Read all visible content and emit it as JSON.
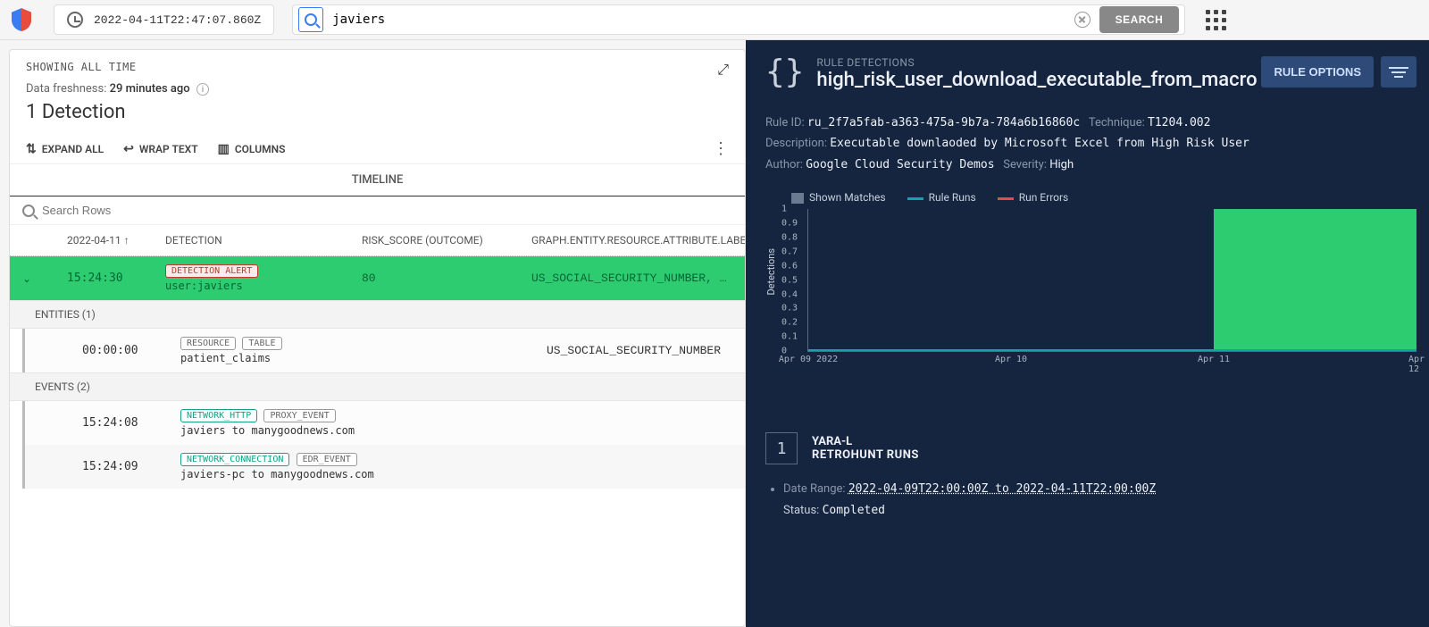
{
  "topbar": {
    "timestamp": "2022-04-11T22:47:07.860Z",
    "search_value": "javiers",
    "search_button": "SEARCH"
  },
  "left": {
    "showing": "SHOWING ALL TIME",
    "freshness_label": "Data freshness: ",
    "freshness_value": "29 minutes ago",
    "count": "1 Detection",
    "tools": {
      "expand": "EXPAND ALL",
      "wrap": "WRAP TEXT",
      "columns": "COLUMNS"
    },
    "timeline": "TIMELINE",
    "row_search_placeholder": "Search Rows",
    "columns": {
      "date": "2022-04-11",
      "detection": "DETECTION",
      "risk": "RISK_SCORE (OUTCOME)",
      "graph": "GRAPH.ENTITY.RESOURCE.ATTRIBUTE.LABELS"
    },
    "alert_row": {
      "time": "15:24:30",
      "badge": "DETECTION ALERT",
      "detail": "user:javiers",
      "risk": "80",
      "graph": "US_SOCIAL_SECURITY_NUMBER, …"
    },
    "entities_header": "ENTITIES (1)",
    "entity_row": {
      "time": "00:00:00",
      "badges": [
        "RESOURCE",
        "TABLE"
      ],
      "detail": "patient_claims",
      "graph": "US_SOCIAL_SECURITY_NUMBER"
    },
    "events_header": "EVENTS (2)",
    "events": [
      {
        "time": "15:24:08",
        "badges": [
          {
            "text": "NETWORK_HTTP",
            "cls": "teal"
          },
          {
            "text": "PROXY_EVENT",
            "cls": "gray"
          }
        ],
        "detail": "javiers to manygoodnews.com"
      },
      {
        "time": "15:24:09",
        "badges": [
          {
            "text": "NETWORK_CONNECTION",
            "cls": "teal"
          },
          {
            "text": "EDR_EVENT",
            "cls": "gray"
          }
        ],
        "detail": "javiers-pc to manygoodnews.com"
      }
    ]
  },
  "right": {
    "subtitle": "RULE DETECTIONS",
    "title": "high_risk_user_download_executable_from_macro",
    "rule_options": "RULE OPTIONS",
    "meta": {
      "rule_id_label": "Rule ID:",
      "rule_id": "ru_2f7a5fab-a363-475a-9b7a-784a6b16860c",
      "technique_label": "Technique:",
      "technique": "T1204.002",
      "desc_label": "Description:",
      "desc": "Executable downlaoded by Microsoft Excel from High Risk User",
      "author_label": "Author:",
      "author": "Google Cloud Security Demos",
      "severity_label": "Severity:",
      "severity": "High"
    },
    "legend": {
      "shown": "Shown Matches",
      "runs": "Rule Runs",
      "errors": "Run Errors"
    },
    "ylabel": "Detections",
    "retro": {
      "num": "1",
      "l1": "YARA-L",
      "l2": "RETROHUNT RUNS",
      "range_label": "Date Range:",
      "range": "2022-04-09T22:00:00Z to 2022-04-11T22:00:00Z",
      "status_label": "Status:",
      "status": "Completed"
    }
  },
  "chart_data": {
    "type": "bar",
    "categories": [
      "Apr 09 2022",
      "Apr 10",
      "Apr 11",
      "Apr 12"
    ],
    "values": [
      0,
      0,
      1,
      null
    ],
    "ylabel": "Detections",
    "ylim": [
      0,
      1
    ],
    "yticks": [
      0,
      0.1,
      0.2,
      0.3,
      0.4,
      0.5,
      0.6,
      0.7,
      0.8,
      0.9,
      1
    ],
    "series_overlays": [
      "Shown Matches",
      "Rule Runs",
      "Run Errors"
    ]
  }
}
